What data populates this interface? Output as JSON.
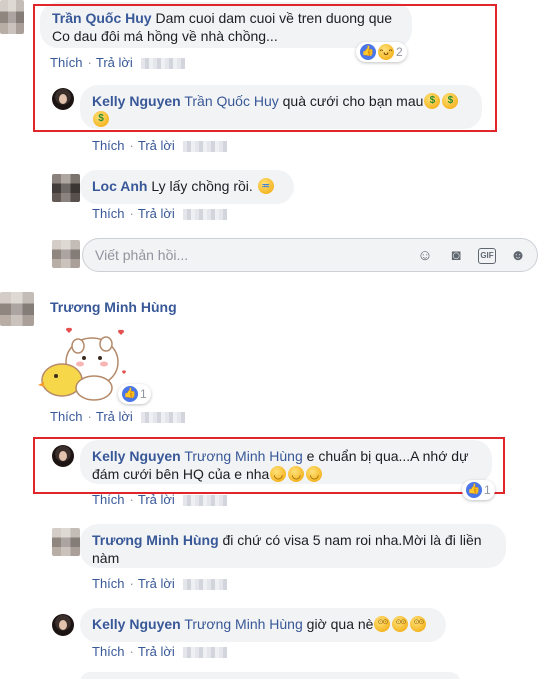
{
  "common": {
    "like_label": "Thích",
    "reply_label": "Trả lời"
  },
  "comments": [
    {
      "author": "Trần Quốc Huy",
      "text": "Dam cuoi dam cuoi về tren duong que Co dau đôi má hồng về nhà chồng...",
      "reaction_count": "2"
    },
    {
      "author": "Kelly Nguyen",
      "mention": "Trần Quốc Huy",
      "text": " quà cưới cho bạn mau"
    },
    {
      "author": "Loc Anh",
      "text": " Ly lấy chồng rồi."
    },
    {
      "author": "Trương Minh Hùng",
      "reaction_count": "1"
    },
    {
      "author": "Kelly Nguyen",
      "mention": "Trương Minh Hùng",
      "text": " e chuẩn bị qua...A nhớ dự đám cưới bên HQ của e nha",
      "reaction_count": "1"
    },
    {
      "author": "Trương Minh Hùng",
      "text": " đi chứ có visa 5 nam roi nha.Mời là đi liền nàm"
    },
    {
      "author": "Kelly Nguyen",
      "mention": "Trương Minh Hùng",
      "text": " giờ qua nè"
    }
  ],
  "reply_box": {
    "placeholder": "Viết phản hồi...",
    "icons": [
      "emoji-icon",
      "camera-icon",
      "gif-icon",
      "sticker-icon"
    ]
  },
  "colors": {
    "link": "#385898",
    "bubble": "#f2f3f5",
    "highlight_border": "#e0252b",
    "like_blue": "#4a76e8"
  }
}
